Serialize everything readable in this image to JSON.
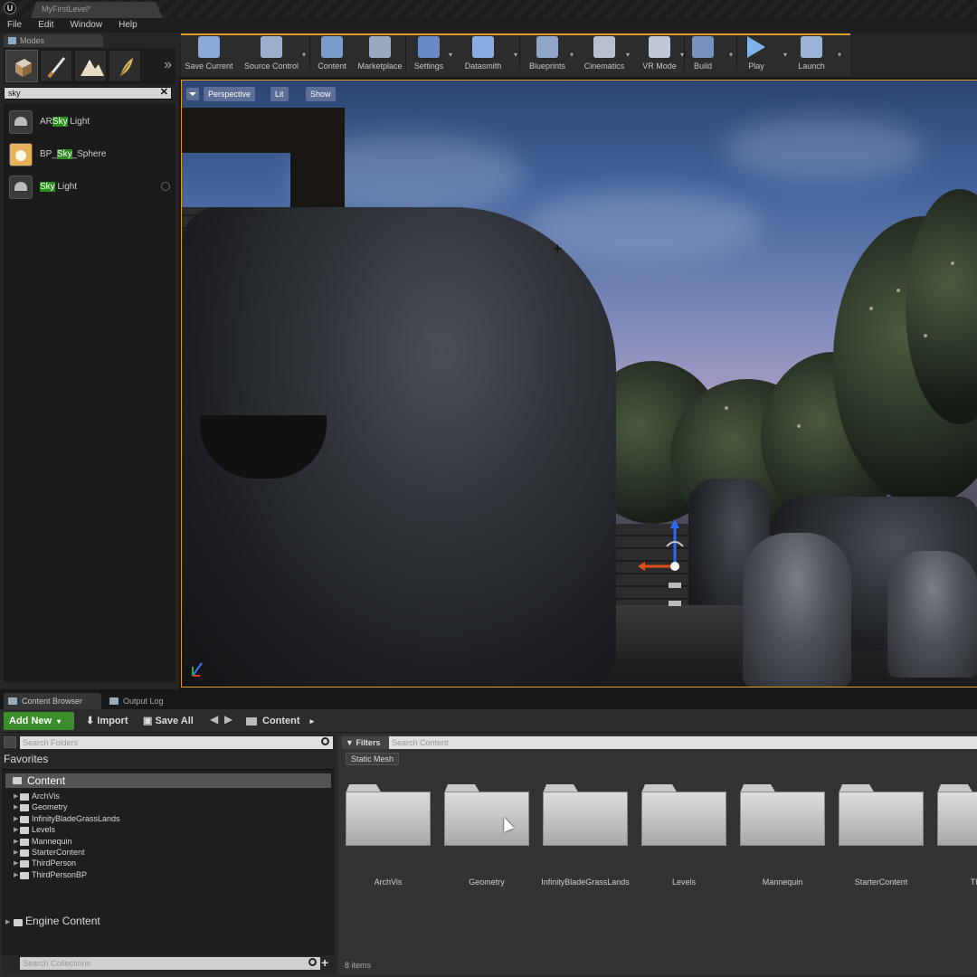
{
  "window": {
    "level_tab": "MyFirstLevel*"
  },
  "menu": [
    "File",
    "Edit",
    "Window",
    "Help"
  ],
  "modes_panel": {
    "tab_label": "Modes",
    "search_value": "sky",
    "results": [
      {
        "before": "AR",
        "match": "Sky",
        "after": " Light",
        "icon": "sky-light-icon"
      },
      {
        "before": "BP_",
        "match": "Sky",
        "after": "_Sphere",
        "icon": "blueprint-icon"
      },
      {
        "before": "",
        "match": "Sky",
        "after": " Light",
        "icon": "sky-light-icon"
      }
    ]
  },
  "toolbar": {
    "accent": "#e09a2a",
    "buttons": [
      {
        "label": "Save Current",
        "icon": "save-icon",
        "color": "#8aa8d8"
      },
      {
        "label": "Source Control",
        "icon": "source-control-icon",
        "color": "#9ab0cc"
      },
      {
        "label": "Content",
        "icon": "content-icon",
        "color": "#7a9ccc"
      },
      {
        "label": "Marketplace",
        "icon": "marketplace-icon",
        "color": "#9aa8c0"
      },
      {
        "label": "Settings",
        "icon": "settings-icon",
        "color": "#6a8cc4"
      },
      {
        "label": "Datasmith",
        "icon": "datasmith-icon",
        "color": "#8aaee0"
      },
      {
        "label": "Blueprints",
        "icon": "blueprints-icon",
        "color": "#8fa6c8"
      },
      {
        "label": "Cinematics",
        "icon": "cinematics-icon",
        "color": "#b8c0d0"
      },
      {
        "label": "VR Mode",
        "icon": "vr-mode-icon",
        "color": "#c0c8dc"
      },
      {
        "label": "Build",
        "icon": "build-icon",
        "color": "#7890c0"
      },
      {
        "label": "Play",
        "icon": "play-icon",
        "color": "#7eb4ea"
      },
      {
        "label": "Launch",
        "icon": "launch-icon",
        "color": "#9ab4d8"
      }
    ]
  },
  "viewport": {
    "view_mode": "Perspective",
    "lighting": "Lit",
    "show": "Show"
  },
  "lower_tabs": {
    "content_browser": "Content Browser",
    "output_log": "Output Log"
  },
  "content_browser": {
    "add_new": "Add New",
    "import": "Import",
    "save_all": "Save All",
    "path": "Content",
    "search_folders_placeholder": "Search Folders",
    "favorites": "Favorites",
    "tree_root": "Content",
    "tree_items": [
      "ArchVis",
      "Geometry",
      "InfinityBladeGrassLands",
      "Levels",
      "Mannequin",
      "StarterContent",
      "ThirdPerson",
      "ThirdPersonBP"
    ],
    "engine_content": "Engine Content",
    "search_collections_placeholder": "Search Collections",
    "filters": "Filters",
    "search_content_placeholder": "Search Content",
    "filter_chip": "Static Mesh",
    "folders": [
      "ArchVis",
      "Geometry",
      "InfinityBladeGrassLands",
      "Levels",
      "Mannequin",
      "StarterContent",
      "Third"
    ],
    "item_count": "8 items",
    "add_new_color": "#3c8e2c"
  }
}
